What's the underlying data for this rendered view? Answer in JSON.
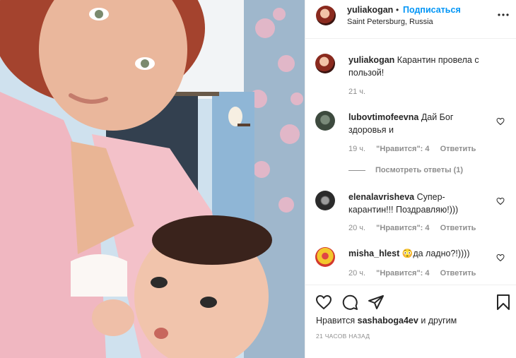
{
  "post": {
    "author": "yuliakogan",
    "dot": "•",
    "follow_label": "Подписаться",
    "location": "Saint Petersburg, Russia"
  },
  "caption": {
    "author": "yuliakogan",
    "text": "Карантин провела с пользой!",
    "time": "21 ч."
  },
  "comments": [
    {
      "author": "lubovtimofeevna",
      "text": "Дай Бог здоровья и",
      "time": "19 ч.",
      "likes": "\"Нравится\": 4",
      "reply_label": "Ответить",
      "view_replies": "Посмотреть ответы (1)"
    },
    {
      "author": "elenalavrisheva",
      "text": "Супер-карантин!!! Поздравляю!)))",
      "time": "20 ч.",
      "likes": "\"Нравится\": 4",
      "reply_label": "Ответить"
    },
    {
      "author": "misha_hlest",
      "text": "😳да ладно?!))))",
      "time": "20 ч.",
      "likes": "\"Нравится\": 4",
      "reply_label": "Ответить"
    }
  ],
  "footer": {
    "likes_prefix": "Нравится",
    "likes_user": "sashaboga4ev",
    "likes_suffix": "и другим",
    "time_ago": "21 ЧАСОВ НАЗАД"
  },
  "icons": {
    "more": "more-horizontal-icon",
    "heart": "heart-icon",
    "comment": "comment-icon",
    "share": "share-icon",
    "save": "bookmark-icon"
  }
}
